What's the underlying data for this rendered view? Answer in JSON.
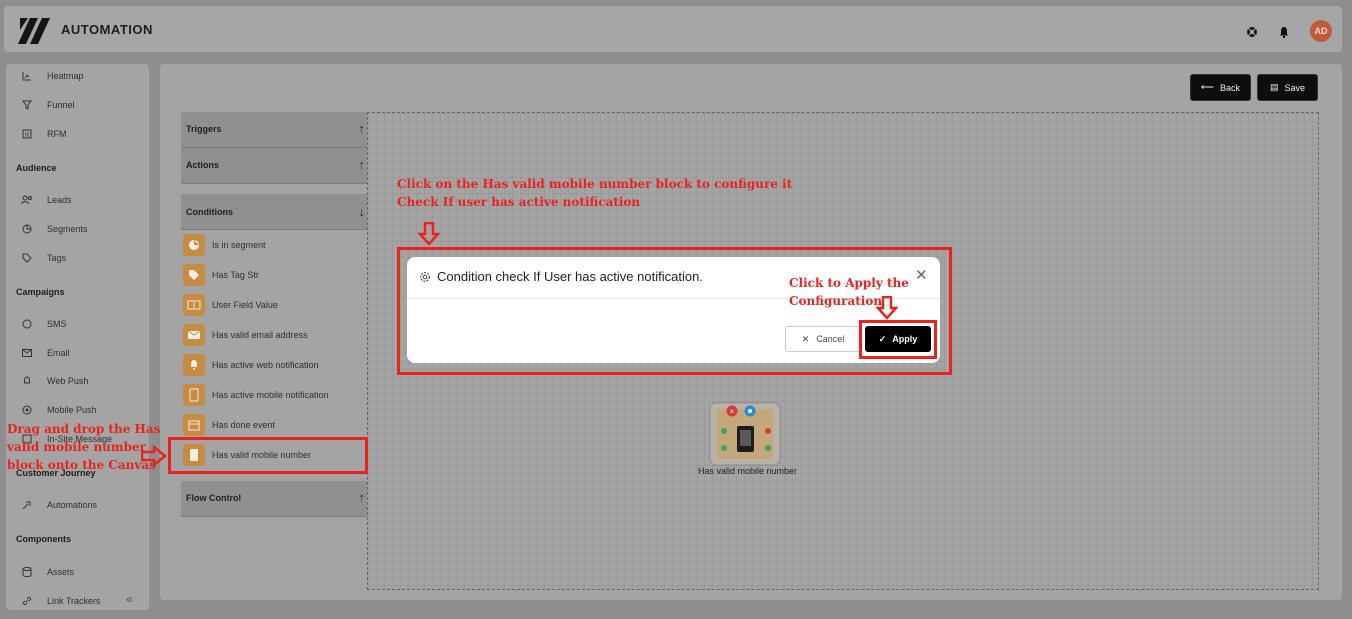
{
  "header": {
    "brand": "AUTOMATION",
    "avatar_initials": "AD"
  },
  "sidebar": {
    "items": [
      {
        "label": "Heatmap",
        "icon": "heatmap-icon"
      },
      {
        "label": "Funnel",
        "icon": "funnel-icon"
      },
      {
        "label": "RFM",
        "icon": "rfm-icon"
      },
      {
        "label": "Leads",
        "icon": "leads-icon"
      },
      {
        "label": "Segments",
        "icon": "segments-icon"
      },
      {
        "label": "Tags",
        "icon": "tags-icon"
      },
      {
        "label": "SMS",
        "icon": "sms-icon"
      },
      {
        "label": "Email",
        "icon": "email-icon"
      },
      {
        "label": "Web Push",
        "icon": "web-push-icon"
      },
      {
        "label": "Mobile Push",
        "icon": "mobile-push-icon"
      },
      {
        "label": "In-Site Message",
        "icon": "in-site-message-icon"
      },
      {
        "label": "Automations",
        "icon": "automations-icon"
      },
      {
        "label": "Assets",
        "icon": "assets-icon"
      },
      {
        "label": "Link Trackers",
        "icon": "link-trackers-icon"
      }
    ],
    "sections": [
      "Audience",
      "Campaigns",
      "Customer Journey",
      "Components"
    ]
  },
  "toolbar": {
    "back_label": "Back",
    "save_label": "Save"
  },
  "panel": {
    "triggers": "Triggers",
    "actions": "Actions",
    "conditions": "Conditions",
    "flow_control": "Flow Control",
    "condition_items": [
      "Is in segment",
      "Has Tag Str",
      "User Field Value",
      "Has valid email address",
      "Has active web notification",
      "Has active mobile notification",
      "Has done event",
      "Has valid mobile number"
    ]
  },
  "modal": {
    "title": "Condition check If User has active notification.",
    "cancel_label": "Cancel",
    "apply_label": "Apply"
  },
  "canvas": {
    "block_label": "Has valid mobile number"
  },
  "annotations": {
    "top_line1": "Click on the Has valid mobile number block to configure it",
    "top_line2": "Check If user has active notification",
    "apply_line1": "Click to Apply the",
    "apply_line2": "Configuration",
    "drag_line1": "Drag and drop the Has",
    "drag_line2": "valid mobile number",
    "drag_line3": "block onto the Canvas"
  },
  "colors": {
    "annotation_red": "#e8231f",
    "block_orange": "#c68c42",
    "apply_black": "#000000"
  }
}
